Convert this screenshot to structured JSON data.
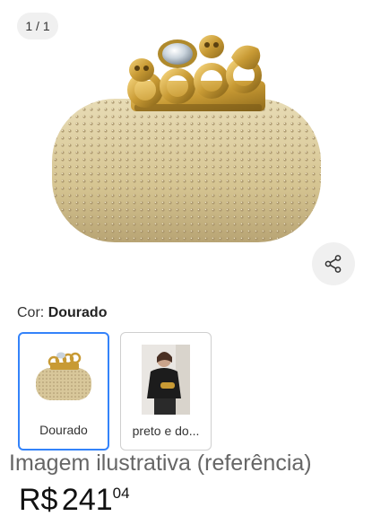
{
  "gallery": {
    "page_counter": "1 / 1",
    "share_icon": "share-icon"
  },
  "color": {
    "label": "Cor:",
    "selected": "Dourado"
  },
  "variants": [
    {
      "label": "Dourado",
      "selected": true
    },
    {
      "label": "preto e do...",
      "selected": false
    }
  ],
  "image_caption": "Imagem ilustrativa (referência)",
  "price": {
    "symbol": "R$",
    "amount": "241",
    "cents": "04"
  },
  "colors": {
    "accent": "#3483fa",
    "gold": "#d8c79a"
  }
}
